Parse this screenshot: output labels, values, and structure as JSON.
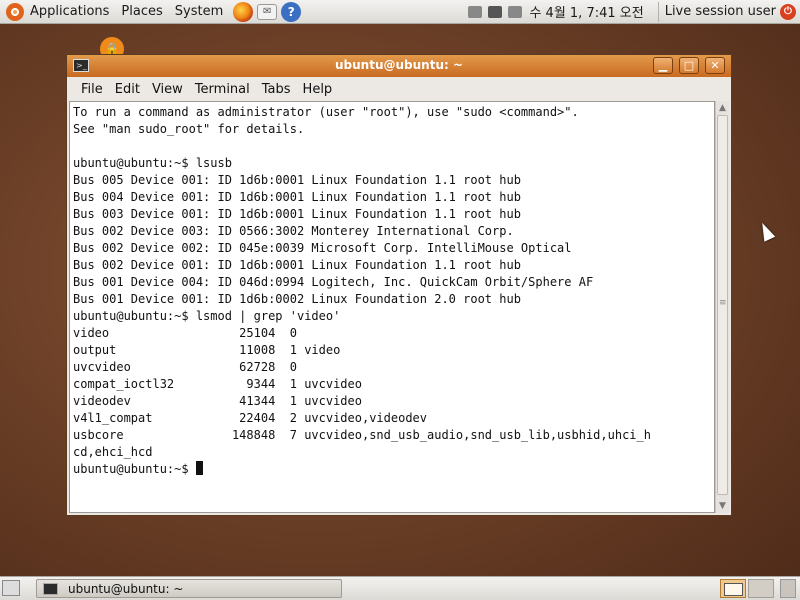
{
  "top_panel": {
    "applications": "Applications",
    "places": "Places",
    "system": "System",
    "clock": "수 4월  1,  7:41 오전",
    "session": "Live session user"
  },
  "window": {
    "title": "ubuntu@ubuntu: ~",
    "menu": [
      "File",
      "Edit",
      "View",
      "Terminal",
      "Tabs",
      "Help"
    ],
    "terminal_lines": [
      "To run a command as administrator (user \"root\"), use \"sudo <command>\".",
      "See \"man sudo_root\" for details.",
      "",
      "ubuntu@ubuntu:~$ lsusb",
      "Bus 005 Device 001: ID 1d6b:0001 Linux Foundation 1.1 root hub",
      "Bus 004 Device 001: ID 1d6b:0001 Linux Foundation 1.1 root hub",
      "Bus 003 Device 001: ID 1d6b:0001 Linux Foundation 1.1 root hub",
      "Bus 002 Device 003: ID 0566:3002 Monterey International Corp.",
      "Bus 002 Device 002: ID 045e:0039 Microsoft Corp. IntelliMouse Optical",
      "Bus 002 Device 001: ID 1d6b:0001 Linux Foundation 1.1 root hub",
      "Bus 001 Device 004: ID 046d:0994 Logitech, Inc. QuickCam Orbit/Sphere AF",
      "Bus 001 Device 001: ID 1d6b:0002 Linux Foundation 2.0 root hub",
      "ubuntu@ubuntu:~$ lsmod | grep 'video'",
      "video                  25104  0",
      "output                 11008  1 video",
      "uvcvideo               62728  0",
      "compat_ioctl32          9344  1 uvcvideo",
      "videodev               41344  1 uvcvideo",
      "v4l1_compat            22404  2 uvcvideo,videodev",
      "usbcore               148848  7 uvcvideo,snd_usb_audio,snd_usb_lib,usbhid,uhci_h",
      "cd,ehci_hcd"
    ],
    "prompt": "ubuntu@ubuntu:~$ "
  },
  "taskbar": {
    "window_label": "ubuntu@ubuntu: ~"
  },
  "colors": {
    "titlebar": "#d4782e",
    "desktop": "#6e4128",
    "power": "#d8401f"
  },
  "icons": [
    "ubuntu-logo-icon",
    "firefox-icon",
    "mail-icon",
    "help-icon",
    "terminal-icon",
    "power-icon",
    "network-icon",
    "volume-icon"
  ]
}
